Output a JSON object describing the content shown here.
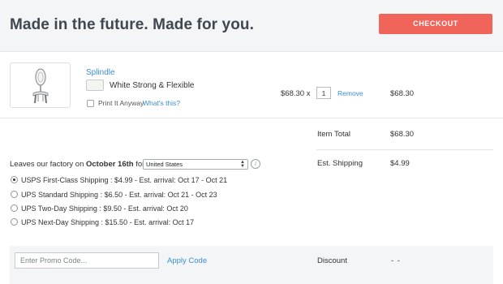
{
  "header": {
    "title": "Made in the future. Made for you.",
    "checkout_label": "CHECKOUT"
  },
  "colors": {
    "accent_button": "#f0645a",
    "link": "#3a8fd0",
    "header_bg": "#f4f5f6"
  },
  "item": {
    "image_icon": "product-thumbnail",
    "name": "Splindle",
    "material": "White Strong & Flexible",
    "print_anyway_label": "Print It Anyway",
    "whats_this_label": "What's this?",
    "unit_price": "$68.30 x",
    "quantity": "1",
    "remove_label": "Remove",
    "line_total": "$68.30"
  },
  "totals": {
    "item_total_label": "Item Total",
    "item_total_value": "$68.30",
    "shipping_label": "Est. Shipping",
    "shipping_value": "$4.99"
  },
  "shipping": {
    "leaves_prefix": "Leaves our factory on ",
    "leaves_date": "October 16th",
    "leaves_suffix": " for",
    "country_selected": "United States",
    "options": [
      {
        "label": "USPS First-Class Shipping : $4.99 - Est. arrival: Oct 17 - Oct 21",
        "selected": true
      },
      {
        "label": "UPS Standard Shipping : $6.50 - Est. arrival: Oct 21 - Oct 23",
        "selected": false
      },
      {
        "label": "UPS Two-Day Shipping : $9.50 - Est. arrival: Oct 20",
        "selected": false
      },
      {
        "label": "UPS Next-Day Shipping : $15.50 - Est. arrival: Oct 17",
        "selected": false
      }
    ]
  },
  "promo": {
    "placeholder": "Enter Promo Code...",
    "apply_label": "Apply Code",
    "discount_label": "Discount",
    "discount_value": "- -"
  }
}
